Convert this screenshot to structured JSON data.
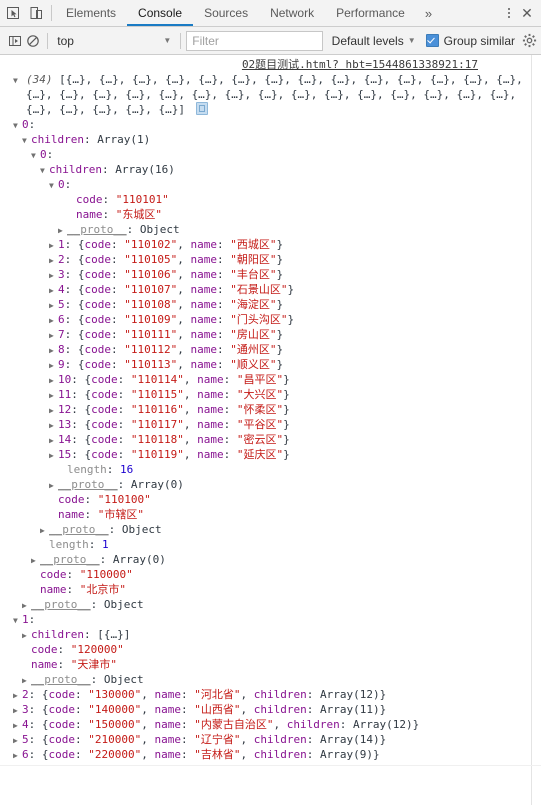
{
  "window": {
    "tabs": [
      {
        "label": "Elements",
        "active": false
      },
      {
        "label": "Console",
        "active": true
      },
      {
        "label": "Sources",
        "active": false
      },
      {
        "label": "Network",
        "active": false
      },
      {
        "label": "Performance",
        "active": false
      }
    ],
    "more_label": "»",
    "inspect_icon": "inspect-element-icon",
    "device_icon": "device-toolbar-icon",
    "menu_icon": "kebab-menu-icon",
    "close_icon": "close-icon"
  },
  "toolbar": {
    "sidebar_icon": "console-sidebar-icon",
    "clear_icon": "clear-console-icon",
    "context": "top",
    "filter_placeholder": "Filter",
    "levels_label": "Default levels",
    "group_similar_label": "Group similar",
    "group_similar_checked": true,
    "settings_icon": "gear-icon",
    "caret": "▼"
  },
  "console": {
    "source_link": "02题目测试.html?  hbt=1544861338921:17",
    "array_count": "(34)",
    "preview_open": "[",
    "preview_item": "{…}",
    "preview_items_total": 34,
    "preview_close": "]",
    "copy_icon": "copy-to-clipboard-icon",
    "toggle_expanded": "▼",
    "toggle_collapsed": "▶",
    "labels": {
      "children": "children",
      "code": "code",
      "name": "name",
      "length": "length",
      "proto": "__proto__",
      "object": "Object",
      "array0": "Array(0)",
      "array1": "Array(1)",
      "array16": "Array(16)",
      "children_collapsed": "[{…}]"
    },
    "beijing": {
      "index": "0",
      "code": "110000",
      "name": "北京市",
      "children_label": "Array(1)",
      "sub": {
        "index": "0",
        "code": "110100",
        "name": "市辖区",
        "children_label": "Array(16)",
        "length": "1",
        "districts_length": "16",
        "first": {
          "index": "0",
          "code": "110101",
          "name": "东城区"
        },
        "rest": [
          {
            "index": "1",
            "code": "110102",
            "name": "西城区"
          },
          {
            "index": "2",
            "code": "110105",
            "name": "朝阳区"
          },
          {
            "index": "3",
            "code": "110106",
            "name": "丰台区"
          },
          {
            "index": "4",
            "code": "110107",
            "name": "石景山区"
          },
          {
            "index": "5",
            "code": "110108",
            "name": "海淀区"
          },
          {
            "index": "6",
            "code": "110109",
            "name": "门头沟区"
          },
          {
            "index": "7",
            "code": "110111",
            "name": "房山区"
          },
          {
            "index": "8",
            "code": "110112",
            "name": "通州区"
          },
          {
            "index": "9",
            "code": "110113",
            "name": "顺义区"
          },
          {
            "index": "10",
            "code": "110114",
            "name": "昌平区"
          },
          {
            "index": "11",
            "code": "110115",
            "name": "大兴区"
          },
          {
            "index": "12",
            "code": "110116",
            "name": "怀柔区"
          },
          {
            "index": "13",
            "code": "110117",
            "name": "平谷区"
          },
          {
            "index": "14",
            "code": "110118",
            "name": "密云区"
          },
          {
            "index": "15",
            "code": "110119",
            "name": "延庆区"
          }
        ]
      }
    },
    "tianjin": {
      "index": "1",
      "code": "120000",
      "name": "天津市",
      "children_label": "[{…}]"
    },
    "provinces": [
      {
        "index": "2",
        "code": "130000",
        "name": "河北省",
        "children": "Array(12)"
      },
      {
        "index": "3",
        "code": "140000",
        "name": "山西省",
        "children": "Array(11)"
      },
      {
        "index": "4",
        "code": "150000",
        "name": "内蒙古自治区",
        "children": "Array(12)"
      },
      {
        "index": "5",
        "code": "210000",
        "name": "辽宁省",
        "children": "Array(14)"
      },
      {
        "index": "6",
        "code": "220000",
        "name": "吉林省",
        "children": "Array(9)"
      }
    ]
  }
}
